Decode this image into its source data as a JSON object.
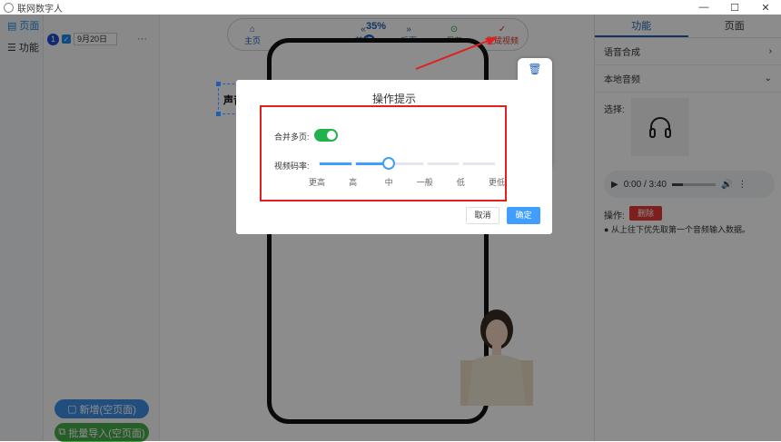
{
  "window": {
    "title": "联网数字人",
    "min": "—",
    "max": "☐",
    "close": "✕"
  },
  "leftnav": {
    "items": [
      {
        "icon": "page-icon",
        "label": "页面"
      },
      {
        "icon": "func-icon",
        "label": "功能"
      }
    ]
  },
  "pagelist": {
    "index": "1",
    "name": "9月20日",
    "more": "···",
    "new_button": "新增(空页面)",
    "import_button": "批量导入(空页面)"
  },
  "toolbar": {
    "zoom": "35%",
    "zoom_value": 0.35,
    "items": [
      {
        "icon": "home-icon",
        "label": "主页"
      },
      {
        "icon": "prev-icon",
        "label": "前页"
      },
      {
        "icon": "next-icon",
        "label": "后页"
      },
      {
        "icon": "save-icon",
        "label": "保存"
      },
      {
        "icon": "check-icon",
        "label": "生成视频"
      }
    ]
  },
  "canvas": {
    "selected_text": "声音"
  },
  "rightpanel": {
    "tabs": [
      "功能",
      "页面"
    ],
    "sections": [
      "语音合成",
      "本地音频"
    ],
    "select_label": "选择:",
    "audio_time": "0:00 / 3:40",
    "op_label": "操作:",
    "delete_button": "删除",
    "note": "从上往下优先取第一个音频输入数据。"
  },
  "dialog": {
    "title": "操作提示",
    "merge_label": "合并多页:",
    "merge_on": true,
    "rate_label": "视频码率:",
    "rate_levels": [
      "更高",
      "高",
      "中",
      "一般",
      "低",
      "更低"
    ],
    "rate_selected": "中",
    "cancel_button": "取消",
    "ok_button": "确定"
  },
  "colors": {
    "accent": "#409eff",
    "toggle": "#22b24c",
    "highlight": "#e02020"
  }
}
